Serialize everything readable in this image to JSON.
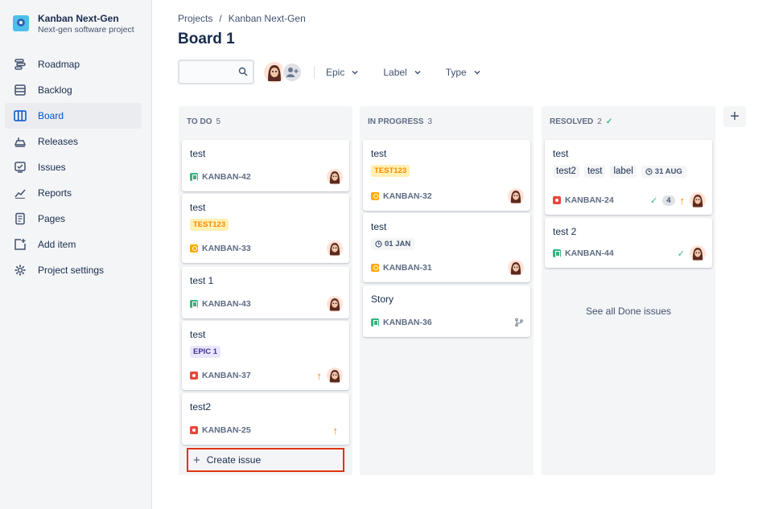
{
  "project": {
    "name": "Kanban Next-Gen",
    "type": "Next-gen software project"
  },
  "nav": [
    {
      "label": "Roadmap",
      "icon": "roadmap-icon"
    },
    {
      "label": "Backlog",
      "icon": "backlog-icon"
    },
    {
      "label": "Board",
      "icon": "board-icon",
      "active": true
    },
    {
      "label": "Releases",
      "icon": "releases-icon"
    },
    {
      "label": "Issues",
      "icon": "issues-icon"
    },
    {
      "label": "Reports",
      "icon": "reports-icon"
    },
    {
      "label": "Pages",
      "icon": "pages-icon"
    },
    {
      "label": "Add item",
      "icon": "add-item-icon"
    },
    {
      "label": "Project settings",
      "icon": "gear-icon"
    }
  ],
  "breadcrumb": {
    "root": "Projects",
    "separator": "/",
    "current": "Kanban Next-Gen"
  },
  "page_title": "Board 1",
  "search": {
    "placeholder": ""
  },
  "filters": {
    "epic": "Epic",
    "label": "Label",
    "type": "Type"
  },
  "columns": {
    "todo": {
      "name": "TO DO",
      "count": "5",
      "cards": [
        {
          "title": "test",
          "key": "KANBAN-42",
          "type": "story"
        },
        {
          "title": "test",
          "tag": "TEST123",
          "key": "KANBAN-33",
          "type": "task"
        },
        {
          "title": "test 1",
          "key": "KANBAN-43",
          "type": "story"
        },
        {
          "title": "test",
          "tag": "EPIC 1",
          "key": "KANBAN-37",
          "type": "bug",
          "priority": "high"
        },
        {
          "title": "test2",
          "key": "KANBAN-25",
          "type": "bug",
          "priority": "high"
        }
      ],
      "create_label": "Create issue"
    },
    "inprogress": {
      "name": "IN PROGRESS",
      "count": "3",
      "cards": [
        {
          "title": "test",
          "tag": "TEST123",
          "key": "KANBAN-32",
          "type": "task"
        },
        {
          "title": "test",
          "date": "01 JAN",
          "key": "KANBAN-31",
          "type": "task"
        },
        {
          "title": "Story",
          "key": "KANBAN-36",
          "type": "story"
        }
      ]
    },
    "resolved": {
      "name": "RESOLVED",
      "count": "2",
      "cards": [
        {
          "title": "test",
          "labels": [
            "test2",
            "test",
            "label"
          ],
          "date": "31 AUG",
          "key": "KANBAN-24",
          "type": "bug",
          "subtasks": "4",
          "priority": "high"
        },
        {
          "title": "test 2",
          "key": "KANBAN-44",
          "type": "story"
        }
      ],
      "see_all": "See all Done issues"
    }
  },
  "colors": {
    "accent": "#0052cc",
    "highlight": "#de350b",
    "story": "#36b37e",
    "task": "#ffab00",
    "bug": "#e5493a"
  }
}
